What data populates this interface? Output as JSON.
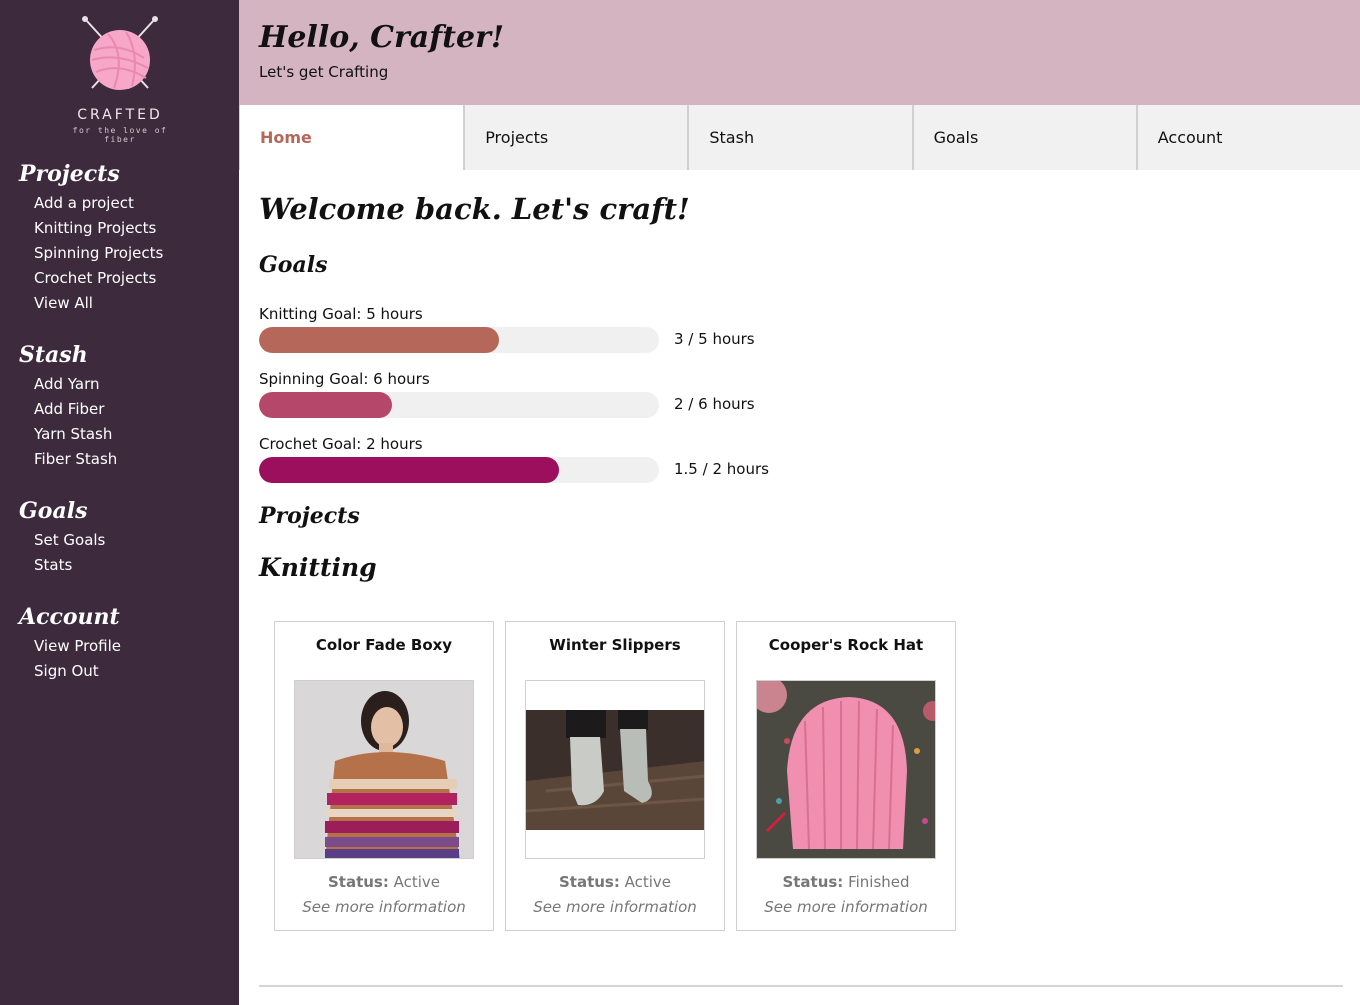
{
  "brand": {
    "name": "CRAFTED",
    "tagline": "for the love of fiber",
    "logo_icon": "yarn-ball-needles-icon",
    "logo_color": "#f7a8c8"
  },
  "sidebar": {
    "sections": [
      {
        "heading": "Projects",
        "items": [
          "Add a project",
          "Knitting Projects",
          "Spinning Projects",
          "Crochet Projects",
          "View All"
        ]
      },
      {
        "heading": "Stash",
        "items": [
          "Add Yarn",
          "Add Fiber",
          "Yarn Stash",
          "Fiber Stash"
        ]
      },
      {
        "heading": "Goals",
        "items": [
          "Set Goals",
          "Stats"
        ]
      },
      {
        "heading": "Account",
        "items": [
          "View Profile",
          "Sign Out"
        ]
      }
    ]
  },
  "header": {
    "title": "Hello, Crafter!",
    "subtitle": "Let's get Crafting"
  },
  "tabs": [
    {
      "label": "Home",
      "active": true
    },
    {
      "label": "Projects",
      "active": false
    },
    {
      "label": "Stash",
      "active": false
    },
    {
      "label": "Goals",
      "active": false
    },
    {
      "label": "Account",
      "active": false
    }
  ],
  "main": {
    "welcome": "Welcome back. Let's craft!",
    "goals_heading": "Goals",
    "goals": [
      {
        "label": "Knitting Goal: 5 hours",
        "progress_text": "3 / 5 hours",
        "progress": 0.6,
        "color": "#b5685a"
      },
      {
        "label": "Spinning Goal: 6 hours",
        "progress_text": "2 / 6 hours",
        "progress": 0.333,
        "color": "#b5476b"
      },
      {
        "label": "Crochet Goal: 2 hours",
        "progress_text": "1.5 / 2 hours",
        "progress": 0.75,
        "color": "#9b0f5c"
      }
    ],
    "projects_heading": "Projects",
    "knitting_heading": "Knitting",
    "projects": [
      {
        "title": "Color Fade Boxy",
        "status_label": "Status:",
        "status": "Active",
        "more": "See more information",
        "image": "sweater-photo"
      },
      {
        "title": "Winter Slippers",
        "status_label": "Status:",
        "status": "Active",
        "more": "See more information",
        "image": "slippers-photo"
      },
      {
        "title": "Cooper's Rock Hat",
        "status_label": "Status:",
        "status": "Finished",
        "more": "See more information",
        "image": "hat-photo"
      }
    ]
  },
  "colors": {
    "sidebar_bg": "#3d2b3d",
    "header_bg": "#d4b4c0",
    "tab_active_text": "#b5685a"
  }
}
